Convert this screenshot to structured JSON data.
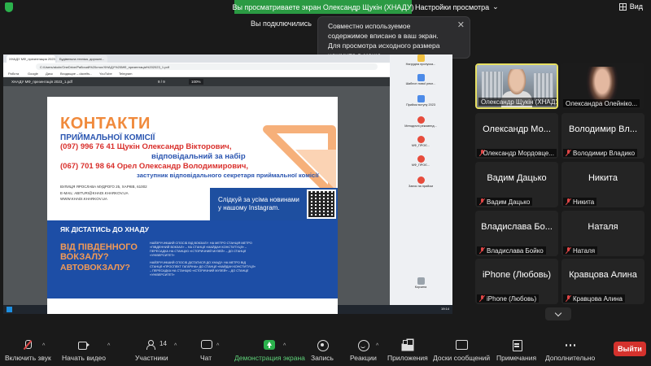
{
  "topbar": {
    "share_banner": "Вы просматриваете экран Олександр Щукін (ХНАДУ)",
    "view_settings": "Настройки просмотра",
    "view_label": "Вид",
    "connected": "Вы подключились",
    "tooltip": "Совместно используемое содержимое вписано в ваш экран. Для просмотра исходного размера нажмите в меню..."
  },
  "browser": {
    "tabs": [
      "ХНАДУ МФ_презентация 2023...",
      "Будівельна техніка, дорожні..."
    ],
    "address": "C:/Users/akoln/OneDrive/Рабочий%20стол/ХНАДУ%20МФ_презентація%202023_1.pdf",
    "bookmarks": [
      "Работа",
      "Google",
      "Диск",
      "Входящие – davelts...",
      "YouTube",
      "Telegram"
    ],
    "pdf_title": "ХНАДУ МФ_презентація 2023_1.pdf",
    "pdf_page": "9 / 9",
    "pdf_zoom": "100%",
    "taskbar_time": "19:14"
  },
  "desktop_icons": [
    {
      "label": "Нагрудна пропуска...",
      "color": "#f0c040"
    },
    {
      "label": "Шаблон нової рекл...",
      "color": "#4d8be8"
    },
    {
      "label": "Прийом вступу 2023",
      "color": "#4d8be8"
    },
    {
      "label": "Методичні рекоменд...",
      "color": "#e74c3c"
    },
    {
      "label": "МФ_ПРОЄ...",
      "color": "#e74c3c"
    },
    {
      "label": "МФ_ПРОЄ...",
      "color": "#e74c3c"
    },
    {
      "label": "Запис на прийом",
      "color": "#e74c3c"
    },
    {
      "label": "Корзина",
      "color": "#9aa3ab"
    }
  ],
  "slide": {
    "title": "КОНТАКТИ",
    "subtitle": "ПРИЙМАЛЬНОЇ КОМІСІЇ",
    "phone1": "(097) 996 76 41 Щукін Олександр Вікторович,",
    "role1": "відповідальний за набір",
    "phone2": "(067) 701 98 64 Орел Олександр Володимирович,",
    "role2": "заступник відповідального секретаря приймальної комісії",
    "address": "ВУЛИЦЯ ЯРОСЛАВА МУДРОГО 25, ХАРКІВ, 61002",
    "email": "E-MAIL: ABITURI@KHADI.KHARKOV.UA",
    "website": "WWW.KHADI.KHARKOV.UA",
    "insta": "Слідкуй за усіма новинами у нашому Instagram.",
    "how_title": "ЯК ДІСТАТИСЬ ДО ХНАДУ",
    "question1": "ВІД ПІВДЕННОГО ВОКЗАЛУ?",
    "question2": "АВТОВОКЗАЛУ?",
    "how_text1": "НАЙЗРУЧНІШИЙ СПОСІБ ВІД ВОКЗАЛУ: НА МЕТРО СТАНЦІЯ МЕТРО «ПІВДЕННИЙ ВОКЗАЛ» – НА СТАНЦІЇ «МАЙДАН КОНСТИТУЦІЇ» – ПЕРЕСАДКА НА СТАНЦІЮ «ІСТОРИЧНИЙ МУЗЕЙ» – ДО СТАНЦІЇ «УНІВЕРСИТЕТ»",
    "how_text2": "НАЙЗРУЧНІШИЙ СПОСІБ ДІСТАТИСЯ ДО ХНАДУ: НА МЕТРО ВІД СТАНЦІЇ «ПРОСПЕКТ ГАГАРІНА» ДО СТАНЦІЇ «МАЙДАН КОНСТИТУЦІЇ» – ПЕРЕСАДКА НА СТАНЦІЮ «ІСТОРИЧНИЙ МУЗЕЙ» – ДО СТАНЦІЇ «УНІВЕРСИТЕТ»"
  },
  "participants": [
    {
      "big": "",
      "label": "Олександр Щукін (ХНАДУ)",
      "muted": false,
      "video": true
    },
    {
      "big": "",
      "label": "Олександра Олейніко...",
      "muted": false,
      "video": true
    },
    {
      "big": "Олександр Мо...",
      "label": "Олександр Мордовце...",
      "muted": true,
      "video": false
    },
    {
      "big": "Володимир Вл...",
      "label": "Володимир Владико",
      "muted": true,
      "video": false
    },
    {
      "big": "Вадим Дацько",
      "label": "Вадим Дацько",
      "muted": true,
      "video": false
    },
    {
      "big": "Никита",
      "label": "Никита",
      "muted": true,
      "video": false
    },
    {
      "big": "Владислава Бо...",
      "label": "Владислава Бойко",
      "muted": true,
      "video": false
    },
    {
      "big": "Наталя",
      "label": "Наталя",
      "muted": true,
      "video": false
    },
    {
      "big": "iPhone (Любовь)",
      "label": "iPhone (Любовь)",
      "muted": true,
      "video": false
    },
    {
      "big": "Кравцова Алина",
      "label": "Кравцова Алина",
      "muted": true,
      "video": false
    }
  ],
  "toolbar": {
    "unmute": "Включить звук",
    "start_video": "Начать видео",
    "participants": "Участники",
    "participants_count": "14",
    "chat": "Чат",
    "share": "Демонстрация экрана",
    "record": "Запись",
    "reactions": "Реакции",
    "apps": "Приложения",
    "whiteboards": "Доски сообщений",
    "notes": "Примечания",
    "more": "Дополнительно",
    "leave": "Выйти"
  },
  "colors": {
    "accent_green": "#2b9a43",
    "leave_red": "#d4322d",
    "active_speaker": "#e7e063",
    "slide_orange": "#f08a3c",
    "slide_blue": "#1d4ea6"
  }
}
